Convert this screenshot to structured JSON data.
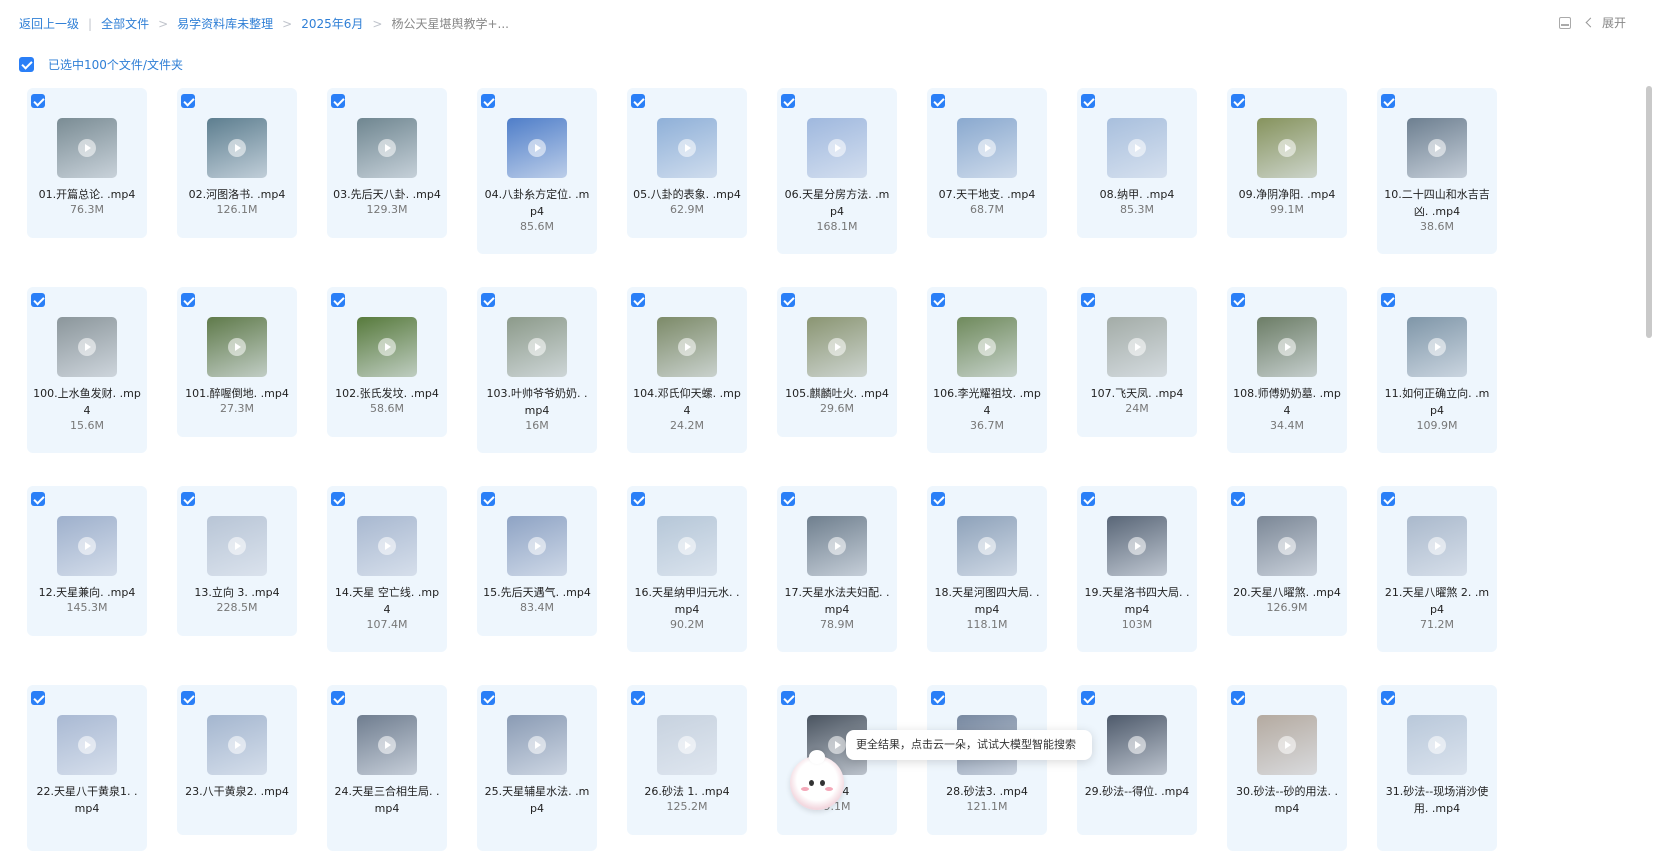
{
  "breadcrumb": {
    "items": [
      "返回上一级",
      "全部文件",
      "易学资料库未整理",
      "2025年6月"
    ],
    "current": "杨公天星堪舆教学+..."
  },
  "header": {
    "expand_label": "展开",
    "layout_icon": "layout-icon",
    "collapse_icon": "chevron-left-icon"
  },
  "selection": {
    "label": "已选中100个文件/文件夹",
    "checked": true
  },
  "files": [
    {
      "name": "01.开篇总论. .mp4",
      "size": "76.3M"
    },
    {
      "name": "02.河图洛书. .mp4",
      "size": "126.1M"
    },
    {
      "name": "03.先后天八卦. .mp4",
      "size": "129.3M"
    },
    {
      "name": "04.八卦糸方定位. .mp4",
      "size": "85.6M"
    },
    {
      "name": "05.八卦的表象. .mp4",
      "size": "62.9M"
    },
    {
      "name": "06.天星分房方法. .mp4",
      "size": "168.1M"
    },
    {
      "name": "07.天干地支. .mp4",
      "size": "68.7M"
    },
    {
      "name": "08.纳甲. .mp4",
      "size": "85.3M"
    },
    {
      "name": "09.净阴净阳. .mp4",
      "size": "99.1M"
    },
    {
      "name": "10.二十四山和水吉吉凶. .mp4",
      "size": "38.6M"
    },
    {
      "name": "100.上水鱼发财. .mp4",
      "size": "15.6M"
    },
    {
      "name": "101.醉喔倒地. .mp4",
      "size": "27.3M"
    },
    {
      "name": "102.张氏发坟. .mp4",
      "size": "58.6M"
    },
    {
      "name": "103.叶帅爷爷奶奶. .mp4",
      "size": "16M"
    },
    {
      "name": "104.邓氏仰天螺. .mp4",
      "size": "24.2M"
    },
    {
      "name": "105.麒麟吐火. .mp4",
      "size": "29.6M"
    },
    {
      "name": "106.李光耀祖坟. .mp4",
      "size": "36.7M"
    },
    {
      "name": "107.飞天凤. .mp4",
      "size": "24M"
    },
    {
      "name": "108.师傅奶奶墓. .mp4",
      "size": "34.4M"
    },
    {
      "name": "11.如何正确立向. .mp4",
      "size": "109.9M"
    },
    {
      "name": "12.天星兼向. .mp4",
      "size": "145.3M"
    },
    {
      "name": "13.立向 3. .mp4",
      "size": "228.5M"
    },
    {
      "name": "14.天星 空亡线. .mp4",
      "size": "107.4M"
    },
    {
      "name": "15.先后天遇气. .mp4",
      "size": "83.4M"
    },
    {
      "name": "16.天星纳甲归元水. .mp4",
      "size": "90.2M"
    },
    {
      "name": "17.天星水法夫妇配. .mp4",
      "size": "78.9M"
    },
    {
      "name": "18.天星河图四大局. .mp4",
      "size": "118.1M"
    },
    {
      "name": "19.天星洛书四大局. .mp4",
      "size": "103M"
    },
    {
      "name": "20.天星八曜煞. .mp4",
      "size": "126.9M"
    },
    {
      "name": "21.天星八曜煞 2. .mp4",
      "size": "71.2M"
    },
    {
      "name": "22.天星八干黄泉1. .mp4",
      "size": ""
    },
    {
      "name": "23.八干黄泉2. .mp4",
      "size": ""
    },
    {
      "name": "24.天星三合相生局. .mp4",
      "size": ""
    },
    {
      "name": "25.天星辅星水法. .mp4",
      "size": ""
    },
    {
      "name": "26.砂法 1. .mp4",
      "size": "125.2M"
    },
    {
      "name": "mp4",
      "size": "9.1M"
    },
    {
      "name": "28.砂法3. .mp4",
      "size": "121.1M"
    },
    {
      "name": "29.砂法--得位. .mp4",
      "size": ""
    },
    {
      "name": "30.砂法--砂的用法. .mp4",
      "size": ""
    },
    {
      "name": "31.砂法--现场消沙使用. .mp4",
      "size": ""
    }
  ],
  "thumb_colors": [
    "#7a8c94",
    "#5d7e8f",
    "#6f8690",
    "#4f7ec9",
    "#8fb0d8",
    "#9fb8de",
    "#8aa9cf",
    "#a8bfdd",
    "#86935d",
    "#6d7f90",
    "#8b969b",
    "#5f7a4a",
    "#577a3c",
    "#8c9a8a",
    "#7c8a68",
    "#8a9572",
    "#6f8a5c",
    "#a3aca7",
    "#6c7d66",
    "#7f96a8",
    "#9eb0cc",
    "#b8c5d6",
    "#a8b8d0",
    "#8ea3c4",
    "#b6c7d8",
    "#6f7f8e",
    "#8ea2ba",
    "#596677",
    "#7b8796",
    "#aab9cc",
    "#a9b9d3",
    "#a4b6cf",
    "#6f7d8f",
    "#8a9bb4",
    "#c7d2df",
    "#4a5460",
    "#7788a0",
    "#4e5a6b",
    "#b4aaa0",
    "#b9c8da"
  ],
  "tooltip": {
    "text": "更全结果，点击云一朵，试试大模型智能搜索"
  }
}
